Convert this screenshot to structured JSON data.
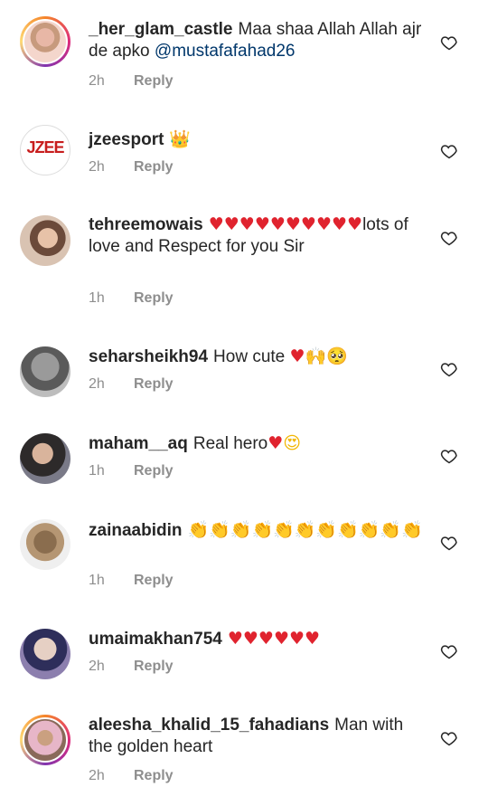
{
  "comments": [
    {
      "username": "_her_glam_castle",
      "text": "Maa shaa Allah Allah ajr de apko",
      "mention": "@mustafafahad26",
      "time": "2h",
      "reply": "Reply"
    },
    {
      "username": "jzeesport",
      "text": "",
      "emojis": "👑",
      "time": "2h",
      "reply": "Reply",
      "avatar_text": "JZEE"
    },
    {
      "username": "tehreemowais",
      "emojis_red": "♥♥♥♥♥♥♥♥♥♥",
      "text": "lots of love and Respect for you Sir",
      "time": "1h",
      "reply": "Reply"
    },
    {
      "username": "seharsheikh94",
      "text": "How cute",
      "emojis_red": "♥",
      "emojis": "🙌🥺",
      "time": "2h",
      "reply": "Reply"
    },
    {
      "username": "maham__aq",
      "text": "Real hero",
      "emojis_red": "♥",
      "emojis": "😍",
      "time": "1h",
      "reply": "Reply"
    },
    {
      "username": "zainaabidin",
      "emojis": "👏👏👏👏👏👏👏👏👏👏👏",
      "time": "1h",
      "reply": "Reply"
    },
    {
      "username": "umaimakhan754",
      "emojis_red": "♥♥♥♥♥♥",
      "time": "2h",
      "reply": "Reply"
    },
    {
      "username": "aleesha_khalid_15_fahadians",
      "text": "Man with the golden heart",
      "time": "2h",
      "reply": "Reply"
    }
  ],
  "colors": {
    "text": "#262626",
    "meta": "#8e8e8e",
    "mention": "#00376b",
    "heart": "#e0232e"
  },
  "icons": {
    "like": "heart-outline-icon"
  }
}
